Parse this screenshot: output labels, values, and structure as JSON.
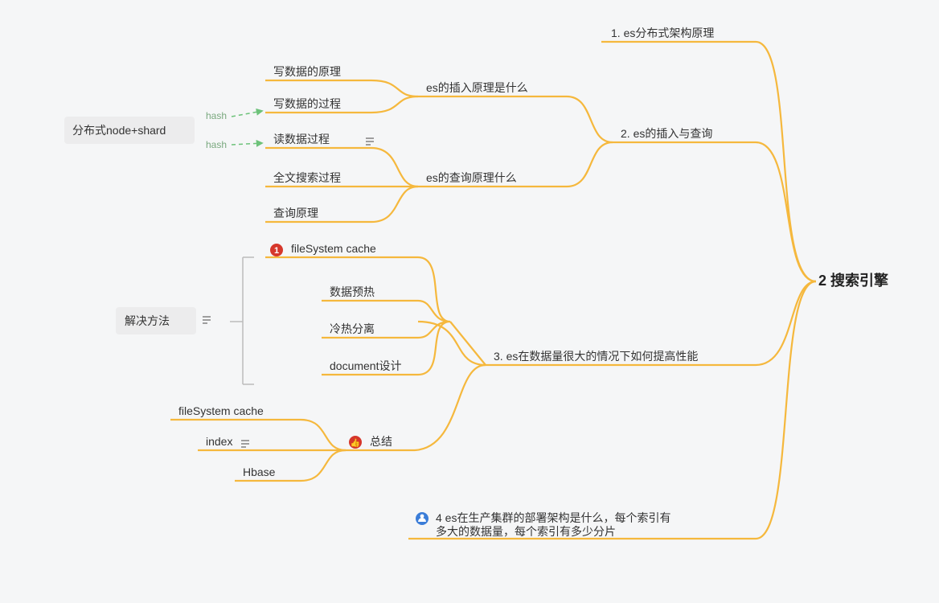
{
  "root": "2 搜索引擎",
  "branch1": "1. es分布式架构原理",
  "branch2": "2. es的插入与查询",
  "branch3": "3. es在数据量很大的情况下如何提高性能",
  "branch4_line1": "4 es在生产集群的部署架构是什么，每个索引有",
  "branch4_line2": "多大的数据量，每个索引有多少分片",
  "b2_insert": "es的插入原理是什么",
  "b2_query": "es的查询原理什么",
  "ins1": "写数据的原理",
  "ins2": "写数据的过程",
  "qry1": "读数据过程",
  "qry2": "全文搜索过程",
  "qry3": "查询原理",
  "dist_node": "分布式node+shard",
  "hash": "hash",
  "solve_title": "解决方法",
  "solve1": "fileSystem cache",
  "solve2": "数据预热",
  "solve3": "冷热分离",
  "solve4": "document设计",
  "summary": "总结",
  "sum1": "fileSystem cache",
  "sum2": "index",
  "sum3": "Hbase",
  "colors": {
    "accent": "#f5b83d",
    "bg": "#f5f6f7",
    "green": "#6dc27a",
    "red": "#d6372b",
    "blue": "#3b7dd8"
  }
}
